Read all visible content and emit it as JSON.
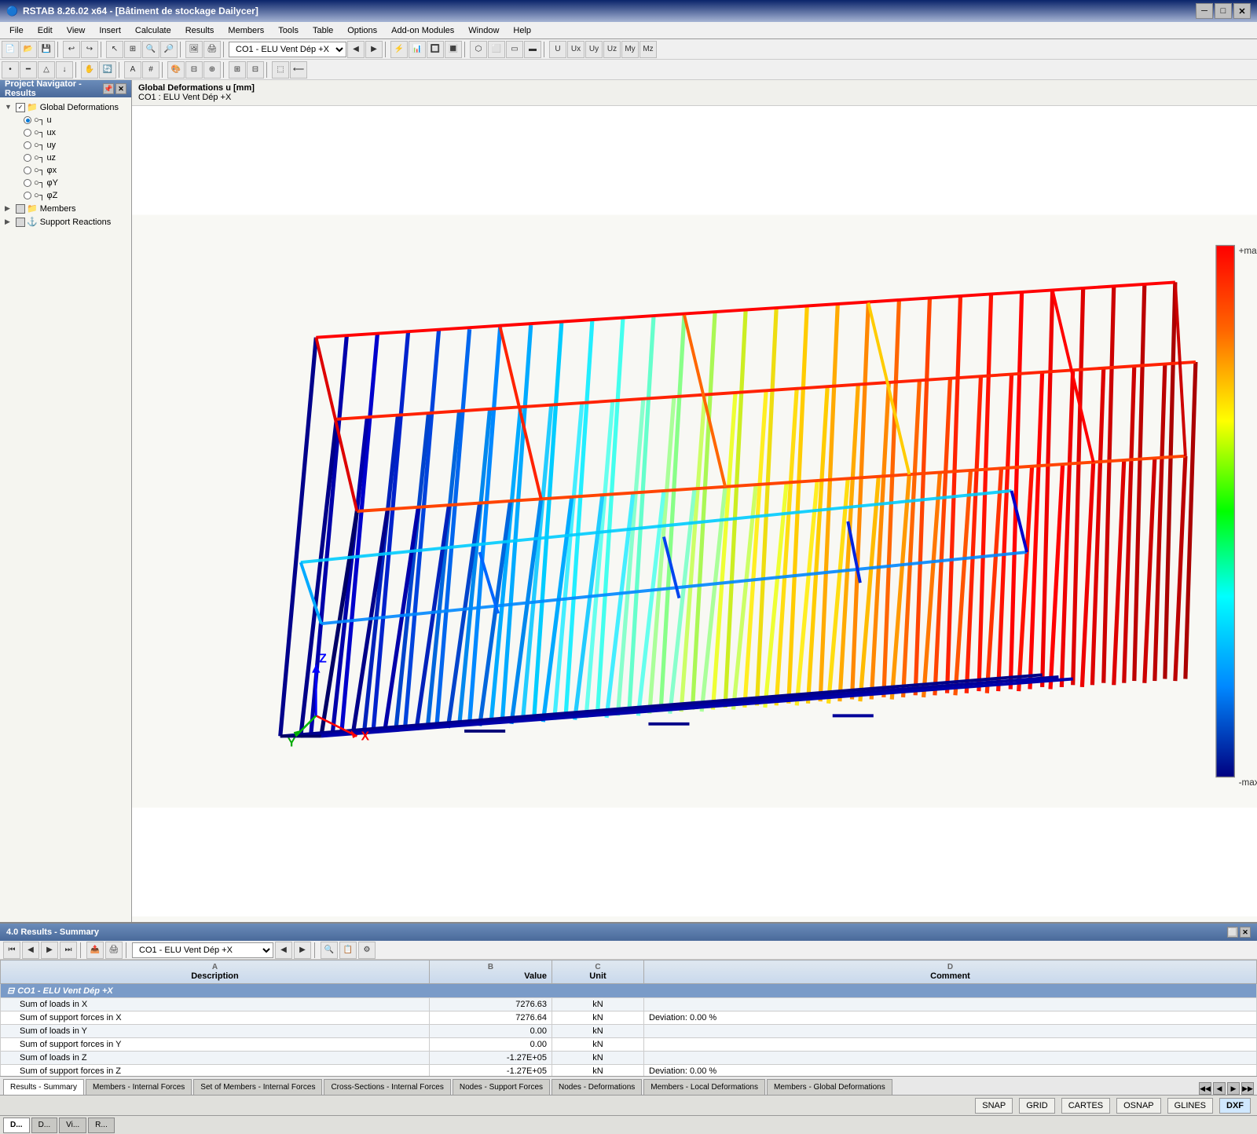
{
  "titleBar": {
    "icon": "🔵",
    "title": "RSTAB 8.26.02 x64 - [Bâtiment de stockage Dailycer]",
    "minBtn": "─",
    "maxBtn": "□",
    "closeBtn": "✕"
  },
  "menuBar": {
    "items": [
      "File",
      "Edit",
      "View",
      "Insert",
      "Calculate",
      "Results",
      "Members",
      "Tools",
      "Table",
      "Options",
      "Add-on Modules",
      "Window",
      "Help"
    ]
  },
  "toolbar1": {
    "combo": "CO1 - ELU Vent Dép +X"
  },
  "viewport": {
    "title": "Global Deformations u [mm]",
    "subtitle": "CO1 : ELU Vent Dép +X"
  },
  "projectNavigator": {
    "title": "Project Navigator - Results",
    "items": [
      {
        "label": "Global Deformations",
        "level": 0,
        "type": "folder",
        "checked": true
      },
      {
        "label": "u",
        "level": 1,
        "type": "radio",
        "active": true
      },
      {
        "label": "ux",
        "level": 1,
        "type": "radio",
        "active": false
      },
      {
        "label": "uy",
        "level": 1,
        "type": "radio",
        "active": false
      },
      {
        "label": "uz",
        "level": 1,
        "type": "radio",
        "active": false
      },
      {
        "label": "φx",
        "level": 1,
        "type": "radio",
        "active": false
      },
      {
        "label": "φY",
        "level": 1,
        "type": "radio",
        "active": false
      },
      {
        "label": "φZ",
        "level": 1,
        "type": "radio",
        "active": false
      },
      {
        "label": "Members",
        "level": 0,
        "type": "folder",
        "checked": false
      },
      {
        "label": "Support Reactions",
        "level": 0,
        "type": "folder",
        "checked": false
      }
    ]
  },
  "bottomPanel": {
    "title": "4.0 Results - Summary",
    "comboValue": "CO1 - ELU Vent Dép +X",
    "tableHeaders": {
      "a": "A",
      "aDesc": "Description",
      "b": "B",
      "bDesc": "Value",
      "c": "C",
      "cDesc": "Unit",
      "d": "D",
      "dDesc": "Comment"
    },
    "rows": [
      {
        "type": "section",
        "desc": "CO1 - ELU Vent Dép +X",
        "value": "",
        "unit": "",
        "comment": ""
      },
      {
        "type": "value",
        "desc": "Sum of loads in X",
        "value": "7276.63",
        "unit": "kN",
        "comment": ""
      },
      {
        "type": "value",
        "desc": "Sum of support forces in X",
        "value": "7276.64",
        "unit": "kN",
        "comment": "Deviation:  0.00 %"
      },
      {
        "type": "value",
        "desc": "Sum of loads in Y",
        "value": "0.00",
        "unit": "kN",
        "comment": ""
      },
      {
        "type": "value",
        "desc": "Sum of support forces in Y",
        "value": "0.00",
        "unit": "kN",
        "comment": ""
      },
      {
        "type": "value",
        "desc": "Sum of loads in Z",
        "value": "-1.27E+05",
        "unit": "kN",
        "comment": ""
      },
      {
        "type": "value",
        "desc": "Sum of support forces in Z",
        "value": "-1.27E+05",
        "unit": "kN",
        "comment": "Deviation:  0.00 %"
      }
    ]
  },
  "bottomTabs": [
    {
      "label": "Results - Summary",
      "active": true
    },
    {
      "label": "Members - Internal Forces",
      "active": false
    },
    {
      "label": "Set of Members - Internal Forces",
      "active": false
    },
    {
      "label": "Cross-Sections - Internal Forces",
      "active": false
    },
    {
      "label": "Nodes - Support Forces",
      "active": false
    },
    {
      "label": "Nodes - Deformations",
      "active": false
    },
    {
      "label": "Members - Local Deformations",
      "active": false
    },
    {
      "label": "Members - Global Deformations",
      "active": false
    }
  ],
  "statusBar": {
    "items": [
      "SNAP",
      "GRID",
      "CARTES",
      "OSNAP",
      "GLINES",
      "DXF"
    ],
    "active": []
  },
  "bottomNavTabs": [
    "D...",
    "D...",
    "Vi...",
    "R..."
  ],
  "colors": {
    "accent": "#0a246a",
    "headerBg": "#6b8cba",
    "tableSectionBg": "#7a9bc8",
    "activeTab": "#ffffff"
  }
}
